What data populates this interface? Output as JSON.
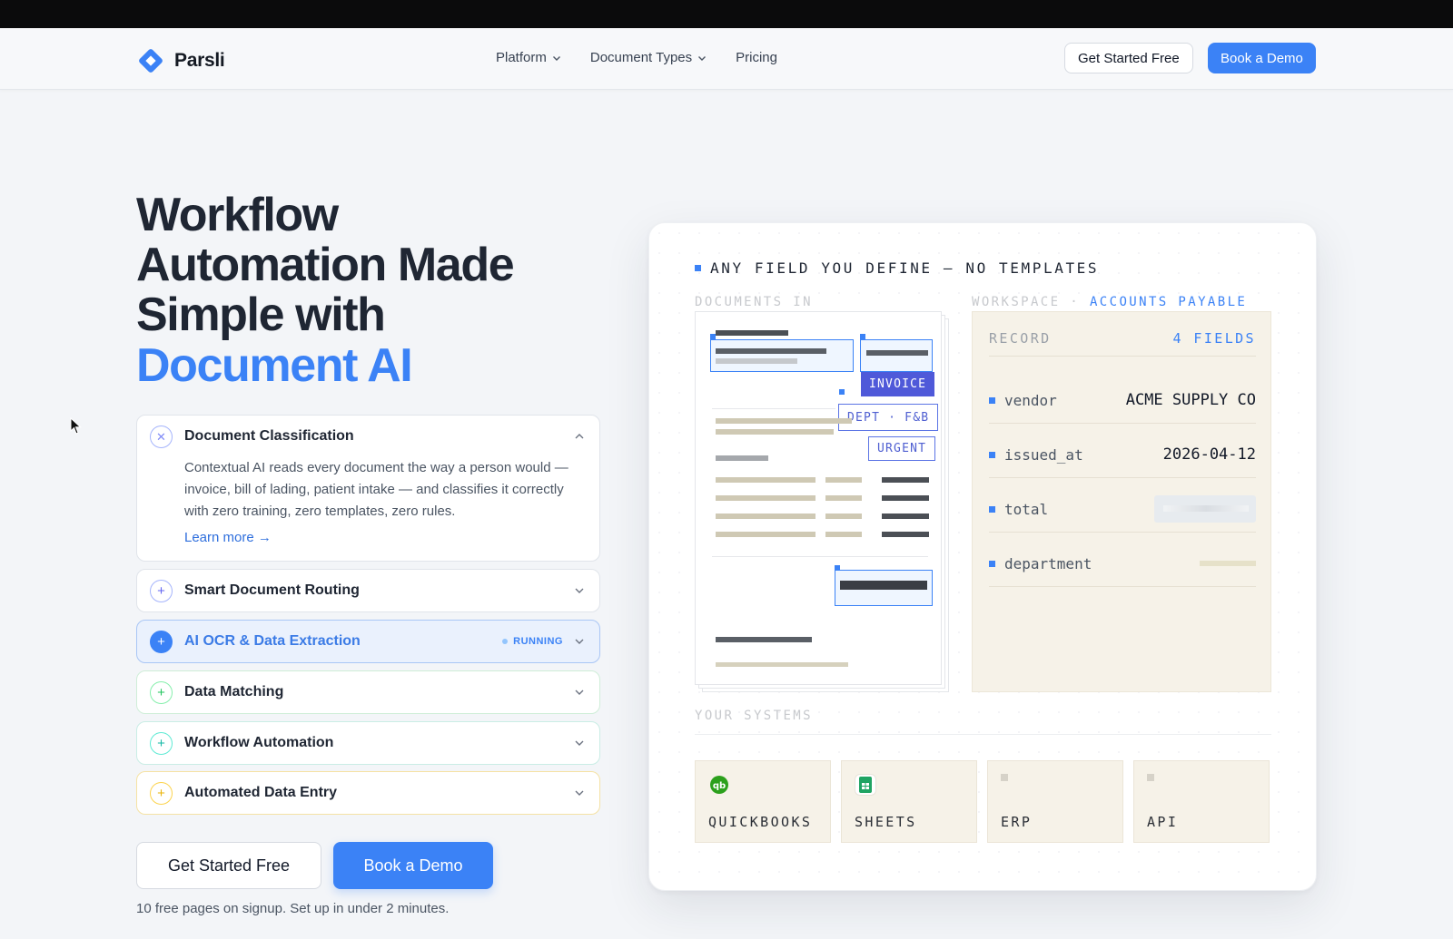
{
  "nav": {
    "brand": "Parsli",
    "links": [
      {
        "label": "Platform",
        "has_menu": true
      },
      {
        "label": "Document Types",
        "has_menu": true
      },
      {
        "label": "Pricing",
        "has_menu": false
      }
    ],
    "get_started": "Get Started Free",
    "book_demo": "Book a Demo"
  },
  "hero": {
    "title_line1": "Workflow",
    "title_line2": "Automation Made",
    "title_line3": "Simple with",
    "title_accent": "Document AI"
  },
  "accordion": [
    {
      "title": "Document Classification",
      "expanded": true,
      "icon": "close-icon",
      "color": "#9ca3af",
      "body": "Contextual AI reads every document the way a person would — invoice, bill of lading, patient intake — and classifies it correctly with zero training, zero templates, zero rules.",
      "link": "Learn more →"
    },
    {
      "title": "Smart Document Routing",
      "expanded": false,
      "icon": "plus-icon",
      "color": "#6366f1"
    },
    {
      "title": "AI OCR & Data Extraction",
      "expanded": false,
      "icon": "plus-icon",
      "color": "#3b82f6",
      "status": "RUNNING"
    },
    {
      "title": "Data Matching",
      "expanded": false,
      "icon": "plus-icon",
      "color": "#22c55e"
    },
    {
      "title": "Workflow Automation",
      "expanded": false,
      "icon": "plus-icon",
      "color": "#14b8a6"
    },
    {
      "title": "Automated Data Entry",
      "expanded": false,
      "icon": "plus-icon",
      "color": "#eab308"
    }
  ],
  "cta": {
    "primary": "Book a Demo",
    "secondary": "Get Started Free",
    "note": "10 free pages on signup. Set up in under 2 minutes."
  },
  "demo": {
    "heading": "ANY FIELD YOU DEFINE — NO TEMPLATES",
    "documents_label": "DOCUMENTS IN",
    "workspace_label": "WORKSPACE ·",
    "workspace_name": "ACCOUNTS PAYABLE",
    "tags": [
      "INVOICE",
      "DEPT · F&B",
      "URGENT"
    ],
    "record_label": "RECORD",
    "record_count": "4 FIELDS",
    "fields": [
      {
        "key": "vendor",
        "value": "ACME SUPPLY CO"
      },
      {
        "key": "issued_at",
        "value": "2026-04-12"
      },
      {
        "key": "total",
        "value": ""
      },
      {
        "key": "department",
        "value": ""
      }
    ],
    "systems_label": "YOUR SYSTEMS",
    "systems": [
      {
        "name": "QUICKBOOKS",
        "icon": "quickbooks-icon"
      },
      {
        "name": "SHEETS",
        "icon": "sheets-icon"
      },
      {
        "name": "ERP",
        "icon": "erp-icon"
      },
      {
        "name": "API",
        "icon": "api-icon"
      }
    ]
  }
}
